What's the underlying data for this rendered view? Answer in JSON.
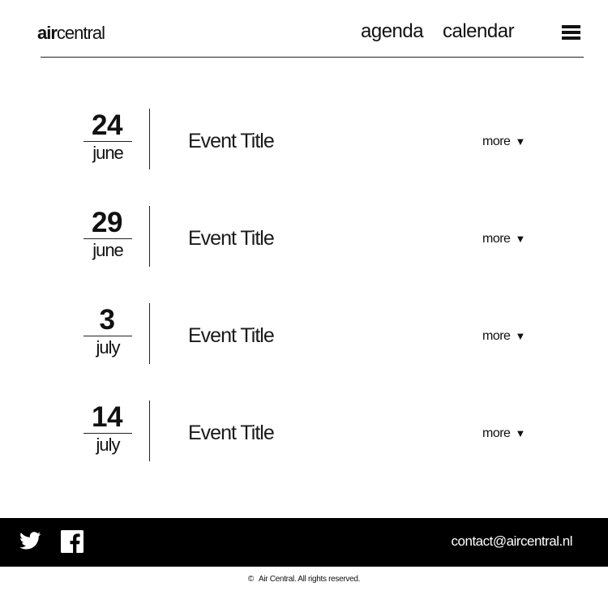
{
  "header": {
    "logo_bold": "air",
    "logo_regular": "central",
    "nav": [
      {
        "label": "agenda"
      },
      {
        "label": "calendar"
      }
    ],
    "menu_icon": "hamburger-menu-icon"
  },
  "events": [
    {
      "day": "24",
      "month": "june",
      "title": "Event Title",
      "more_label": "more",
      "more_icon": "▼"
    },
    {
      "day": "29",
      "month": "june",
      "title": "Event Title",
      "more_label": "more",
      "more_icon": "▼"
    },
    {
      "day": "3",
      "month": "july",
      "title": "Event Title",
      "more_label": "more",
      "more_icon": "▼"
    },
    {
      "day": "14",
      "month": "july",
      "title": "Event Title",
      "more_label": "more",
      "more_icon": "▼"
    }
  ],
  "footer": {
    "social": [
      {
        "icon": "twitter-icon"
      },
      {
        "icon": "facebook-icon"
      }
    ],
    "contact_email": "contact@aircentral.nl",
    "copyright_symbol": "©",
    "copyright_text": "Air Central. All rights reserved.",
    "background_color": "#000000",
    "text_color": "#ffffff"
  }
}
